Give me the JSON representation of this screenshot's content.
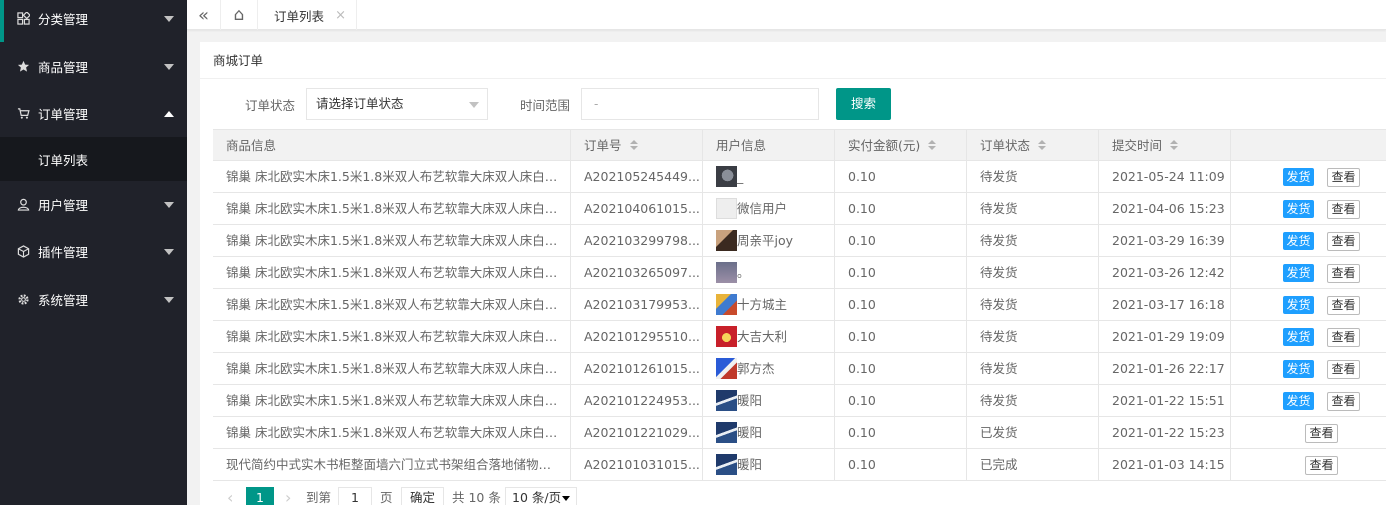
{
  "sidebar": {
    "items": [
      {
        "label": "分类管理",
        "icon": "grid-icon"
      },
      {
        "label": "商品管理",
        "icon": "star-icon"
      },
      {
        "label": "订单管理",
        "icon": "cart-icon"
      },
      {
        "label": "用户管理",
        "icon": "user-icon"
      },
      {
        "label": "插件管理",
        "icon": "cube-icon"
      },
      {
        "label": "系统管理",
        "icon": "gear-icon"
      }
    ],
    "sub_item": "订单列表"
  },
  "tabs": {
    "collapse_icon": "«",
    "home_icon": "⌂",
    "active_label": "订单列表",
    "close_icon": "×"
  },
  "card": {
    "title": "商城订单"
  },
  "filters": {
    "status_label": "订单状态",
    "status_value": "请选择订单状态",
    "range_label": "时间范围",
    "range_placeholder": "-",
    "search_label": "搜索"
  },
  "table": {
    "headers": [
      "商品信息",
      "订单号",
      "用户信息",
      "实付金额(元)",
      "订单状态",
      "提交时间"
    ],
    "ship_label": "发货",
    "view_label": "查看",
    "rows": [
      {
        "product": "锦巢 床北欧实木床1.5米1.8米双人布艺软靠大床双人床白蜡木家具",
        "order": "A202105245449...",
        "user": "_",
        "amount": "0.10",
        "status": "待发货",
        "time": "2021-05-24 11:09",
        "ship": true
      },
      {
        "product": "锦巢 床北欧实木床1.5米1.8米双人布艺软靠大床双人床白蜡木家具",
        "order": "A202104061015...",
        "user": "微信用户",
        "amount": "0.10",
        "status": "待发货",
        "time": "2021-04-06 15:23",
        "ship": true
      },
      {
        "product": "锦巢 床北欧实木床1.5米1.8米双人布艺软靠大床双人床白蜡木家具",
        "order": "A202103299798...",
        "user": "周亲平joy",
        "amount": "0.10",
        "status": "待发货",
        "time": "2021-03-29 16:39",
        "ship": true
      },
      {
        "product": "锦巢 床北欧实木床1.5米1.8米双人布艺软靠大床双人床白蜡木家具",
        "order": "A202103265097...",
        "user": "。",
        "amount": "0.10",
        "status": "待发货",
        "time": "2021-03-26 12:42",
        "ship": true
      },
      {
        "product": "锦巢 床北欧实木床1.5米1.8米双人布艺软靠大床双人床白蜡木家具",
        "order": "A202103179953...",
        "user": "十方城主",
        "amount": "0.10",
        "status": "待发货",
        "time": "2021-03-17 16:18",
        "ship": true
      },
      {
        "product": "锦巢 床北欧实木床1.5米1.8米双人布艺软靠大床双人床白蜡木家具",
        "order": "A202101295510...",
        "user": "大吉大利",
        "amount": "0.10",
        "status": "待发货",
        "time": "2021-01-29 19:09",
        "ship": true
      },
      {
        "product": "锦巢 床北欧实木床1.5米1.8米双人布艺软靠大床双人床白蜡木家具",
        "order": "A202101261015...",
        "user": "郭方杰",
        "amount": "0.10",
        "status": "待发货",
        "time": "2021-01-26 22:17",
        "ship": true
      },
      {
        "product": "锦巢 床北欧实木床1.5米1.8米双人布艺软靠大床双人床白蜡木家具",
        "order": "A202101224953...",
        "user": "暖阳",
        "amount": "0.10",
        "status": "待发货",
        "time": "2021-01-22 15:51",
        "ship": true
      },
      {
        "product": "锦巢 床北欧实木床1.5米1.8米双人布艺软靠大床双人床白蜡木家具",
        "order": "A202101221029...",
        "user": "暖阳",
        "amount": "0.10",
        "status": "已发货",
        "time": "2021-01-22 15:23",
        "ship": false
      },
      {
        "product": "现代简约中式实木书柜整面墙六门立式书架组合落地储物柜家具",
        "order": "A202101031015...",
        "user": "暖阳",
        "amount": "0.10",
        "status": "已完成",
        "time": "2021-01-03 14:15",
        "ship": false
      }
    ]
  },
  "pager": {
    "prev": "‹",
    "current": "1",
    "next": "›",
    "goto_label": "到第",
    "goto_value": "1",
    "page_label": "页",
    "confirm": "确定",
    "total": "共 10 条",
    "page_size": "10 条/页"
  },
  "colors": {
    "sidebar_bg": "#20222a",
    "accent": "#009688",
    "ship_blue": "#1e9fff"
  }
}
